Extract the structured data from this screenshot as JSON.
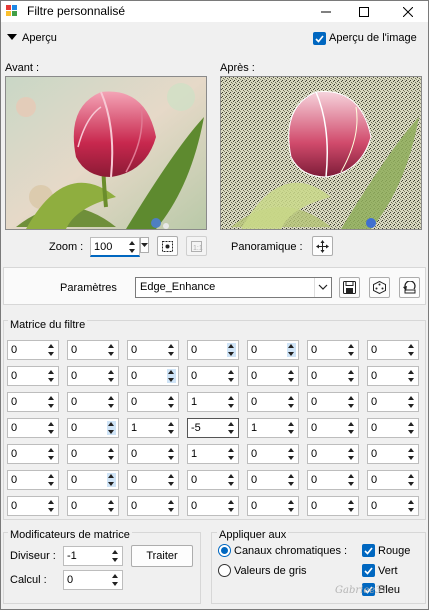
{
  "window": {
    "title": "Filtre personnalisé"
  },
  "preview": {
    "section_label": "Aperçu",
    "show_preview_label": "Aperçu de l'image",
    "show_preview_checked": true,
    "before_label": "Avant :",
    "after_label": "Après :",
    "zoom_label": "Zoom :",
    "zoom_value": "100",
    "pan_label": "Panoramique :"
  },
  "params": {
    "label": "Paramètres",
    "preset": "Edge_Enhance"
  },
  "matrix": {
    "title": "Matrice du filtre",
    "rows": [
      [
        "0",
        "0",
        "0",
        "0",
        "0",
        "0",
        "0"
      ],
      [
        "0",
        "0",
        "0",
        "0",
        "0",
        "0",
        "0"
      ],
      [
        "0",
        "0",
        "0",
        "1",
        "0",
        "0",
        "0"
      ],
      [
        "0",
        "0",
        "1",
        "-5",
        "1",
        "0",
        "0"
      ],
      [
        "0",
        "0",
        "0",
        "1",
        "0",
        "0",
        "0"
      ],
      [
        "0",
        "0",
        "0",
        "0",
        "0",
        "0",
        "0"
      ],
      [
        "0",
        "0",
        "0",
        "0",
        "0",
        "0",
        "0"
      ]
    ]
  },
  "modifiers": {
    "title": "Modificateurs de matrice",
    "divisor_label": "Diviseur :",
    "divisor_value": "-1",
    "calc_label": "Calcul :",
    "calc_value": "0",
    "process_button": "Traiter"
  },
  "apply": {
    "title": "Appliquer aux",
    "chromatic_label": "Canaux chromatiques :",
    "gray_label": "Valeurs de gris",
    "red_label": "Rouge",
    "green_label": "Vert",
    "blue_label": "Bleu"
  },
  "watermark": "Gabriee31",
  "colors": {
    "accent": "#0067c0"
  }
}
